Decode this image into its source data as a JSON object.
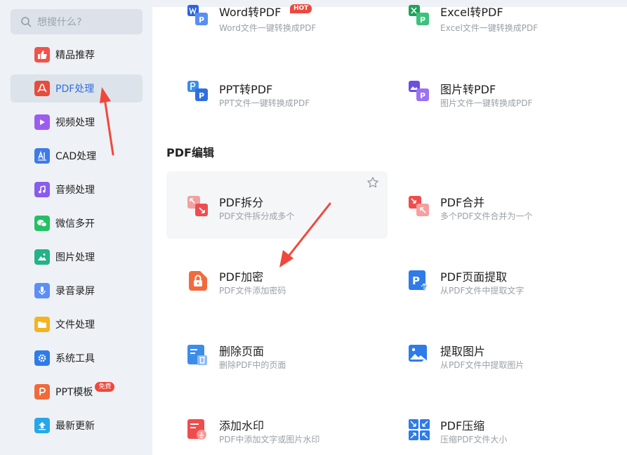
{
  "search": {
    "placeholder": "想搜什么?"
  },
  "sidebar": {
    "items": [
      {
        "label": "精品推荐",
        "color": "#f0534a"
      },
      {
        "label": "PDF处理",
        "color": "#e94b3c",
        "active": true
      },
      {
        "label": "视频处理",
        "color": "#9d5cf0"
      },
      {
        "label": "CAD处理",
        "color": "#3e7be8"
      },
      {
        "label": "音频处理",
        "color": "#8a5bf0"
      },
      {
        "label": "微信多开",
        "color": "#24c065"
      },
      {
        "label": "图片处理",
        "color": "#23b28a"
      },
      {
        "label": "录音录屏",
        "color": "#5b8ff5"
      },
      {
        "label": "文件处理",
        "color": "#f4b31f"
      },
      {
        "label": "系统工具",
        "color": "#2f7be8"
      },
      {
        "label": "PPT模板",
        "color": "#f06a3a",
        "badge": "免费"
      },
      {
        "label": "最新更新",
        "color": "#27a7e8"
      }
    ]
  },
  "main": {
    "section_title": "PDF编辑",
    "hot_badge": "HOT",
    "tools": [
      {
        "title": "Word转PDF",
        "desc": "Word文件一键转换成PDF"
      },
      {
        "title": "Excel转PDF",
        "desc": "Excel文件一键转换成PDF"
      },
      {
        "title": "PPT转PDF",
        "desc": "PPT文件一键转换成PDF"
      },
      {
        "title": "图片转PDF",
        "desc": "图片文件一键转换成PDF"
      },
      {
        "title": "PDF拆分",
        "desc": "PDF文件拆分成多个"
      },
      {
        "title": "PDF合并",
        "desc": "多个PDF文件合并为一个"
      },
      {
        "title": "PDF加密",
        "desc": "PDF文件添加密码"
      },
      {
        "title": "PDF页面提取",
        "desc": "从PDF文件中提取文字"
      },
      {
        "title": "删除页面",
        "desc": "删除PDF中的页面"
      },
      {
        "title": "提取图片",
        "desc": "从PDF文件中提取图片"
      },
      {
        "title": "添加水印",
        "desc": "PDF中添加文字或图片水印"
      },
      {
        "title": "PDF压缩",
        "desc": "压缩PDF文件大小"
      }
    ]
  },
  "colors": {
    "accent": "#2f6fe0",
    "annotation_arrow": "#f0473c"
  }
}
